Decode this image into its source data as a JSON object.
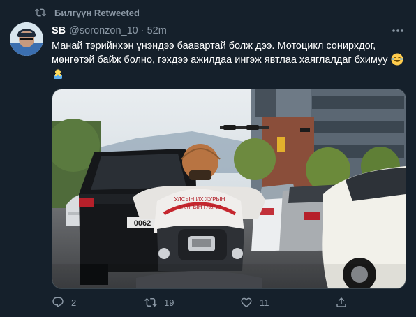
{
  "retweet_banner": {
    "text": "Билгүүн Retweeted",
    "icon": "retweet-icon"
  },
  "author": {
    "name": "SB",
    "handle": "@soronzon_10",
    "separator": "·",
    "time": "52m",
    "avatar_icon": "user-avatar"
  },
  "tweet": {
    "text": "Манай тэрийнхэн үнэндээ баавартай болж дээ. Мотоцикл сонирхдог, мөнгөтэй байж болно, гэхдээ ажилдаа ингэж явтлаа хаяглалдаг бхимуу",
    "trailing_emojis": [
      "face-with-tears-of-joy-emoji",
      "person-bowing-emoji"
    ]
  },
  "media": {
    "type": "photo",
    "jacket_text_line1": "УЛСЫН ИХ ХУРЫН",
    "jacket_text_line2": "ТАМГЫН ГАЗАР",
    "plate_text": "0062"
  },
  "actions": {
    "reply_count": "2",
    "retweet_count": "19",
    "like_count": "11"
  },
  "colors": {
    "background": "#15202b",
    "secondary_text": "#8b98a5",
    "border": "#38444d"
  }
}
